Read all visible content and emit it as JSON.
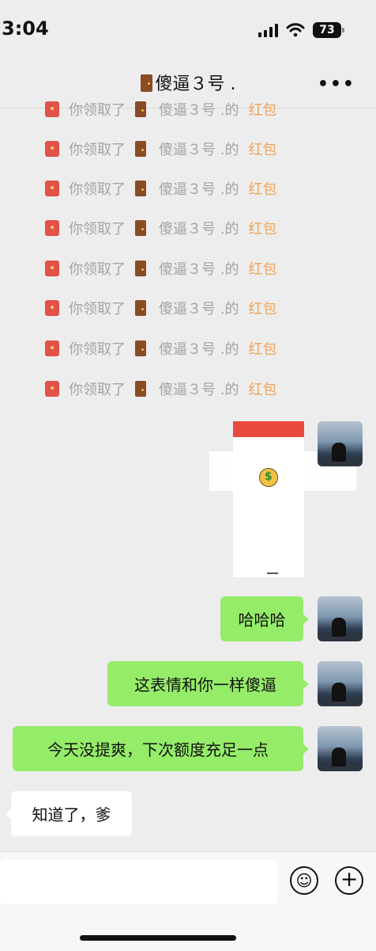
{
  "status_bar": {
    "time": "3:04",
    "battery": "73"
  },
  "nav": {
    "title": "傻逼３号 .",
    "more_icon": "more-icon"
  },
  "notices": [
    {
      "text": "你领取了",
      "name": "傻逼３号 .的",
      "highlight": "红包"
    },
    {
      "text": "你领取了",
      "name": "傻逼３号 .的",
      "highlight": "红包"
    },
    {
      "text": "你领取了",
      "name": "傻逼３号 .的",
      "highlight": "红包"
    },
    {
      "text": "你领取了",
      "name": "傻逼３号 .的",
      "highlight": "红包"
    },
    {
      "text": "你领取了",
      "name": "傻逼３号 .的",
      "highlight": "红包"
    },
    {
      "text": "你领取了",
      "name": "傻逼３号 .的",
      "highlight": "红包"
    },
    {
      "text": "你领取了",
      "name": "傻逼３号 .的",
      "highlight": "红包"
    },
    {
      "text": "你领取了",
      "name": "傻逼３号 .的",
      "highlight": "红包"
    }
  ],
  "messages": [
    {
      "from": "me",
      "text": "哈哈哈"
    },
    {
      "from": "me",
      "text": "这表情和你一样傻逼"
    },
    {
      "from": "me",
      "text": "今天没提爽，下次额度充足一点"
    },
    {
      "from": "other",
      "text": "知道了，爹"
    }
  ],
  "input_bar": {
    "placeholder": "",
    "emoji_icon": "emoji-icon",
    "add_icon": "plus-circle-icon"
  },
  "colors": {
    "accent_green": "#95ec69",
    "redpacket": "#e0524a",
    "highlight": "#f1a457"
  }
}
